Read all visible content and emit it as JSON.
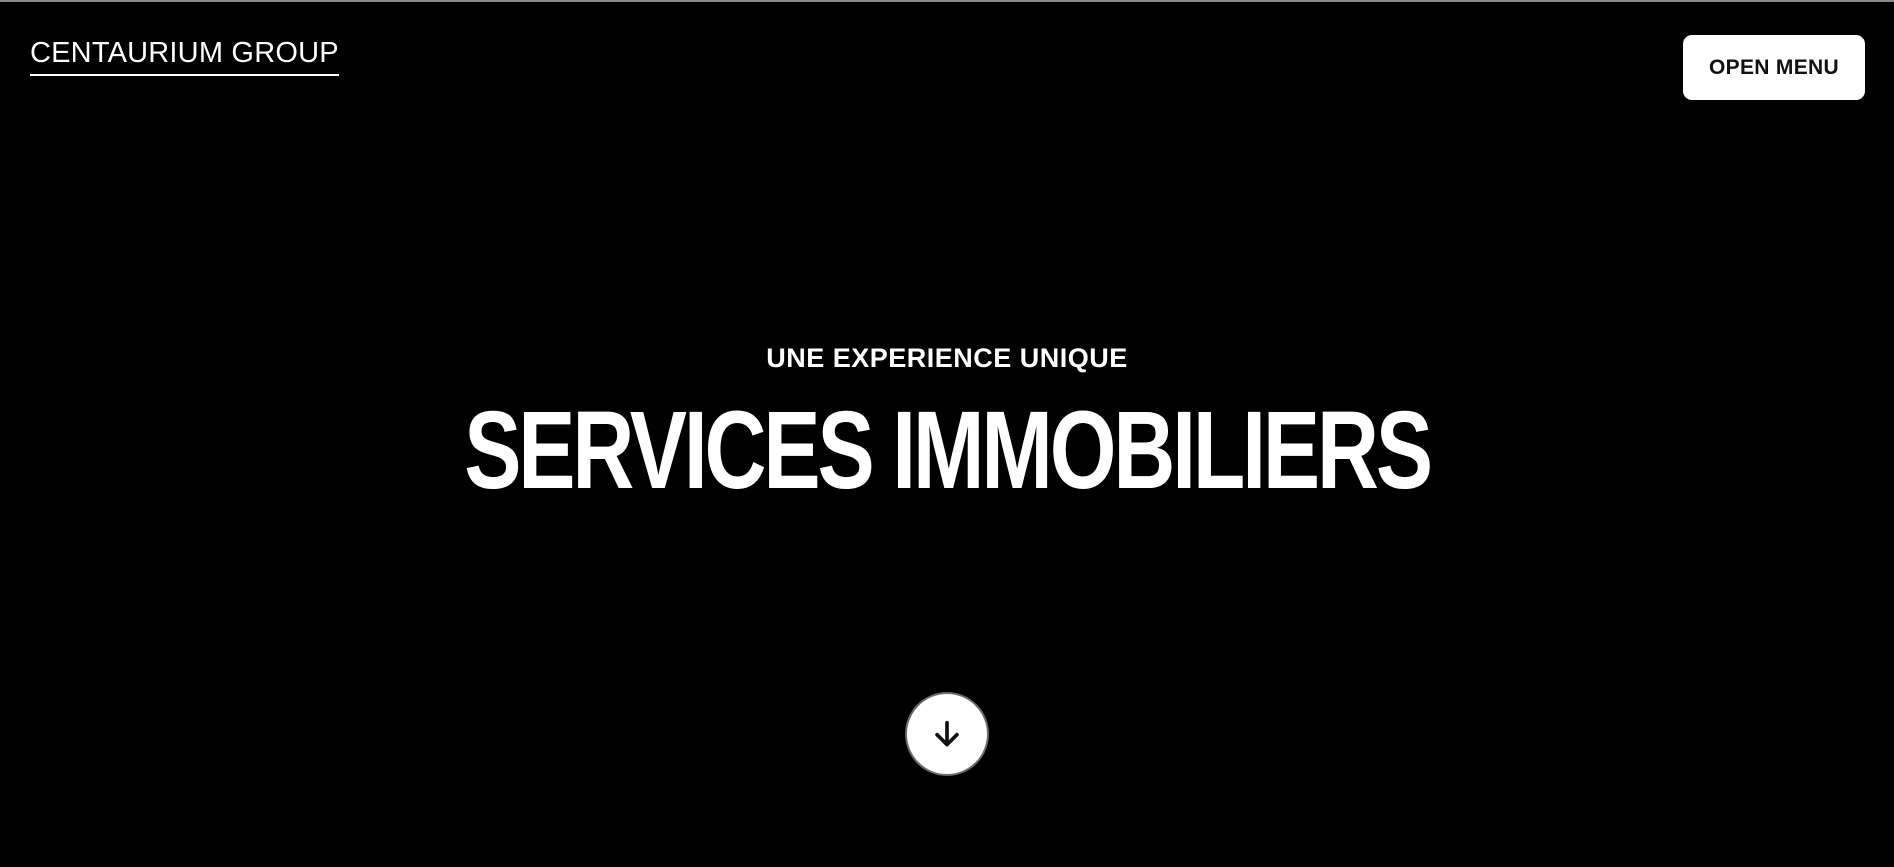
{
  "header": {
    "logo_text": "CENTAURIUM GROUP",
    "menu_button_label": "OPEN MENU"
  },
  "hero": {
    "kicker": "UNE EXPERIENCE UNIQUE",
    "headline": "SERVICES IMMOBILIERS",
    "scroll_icon": "arrow-down-icon"
  },
  "colors": {
    "background": "#000000",
    "text": "#ffffff",
    "button_bg": "#ffffff",
    "button_text": "#111111"
  }
}
